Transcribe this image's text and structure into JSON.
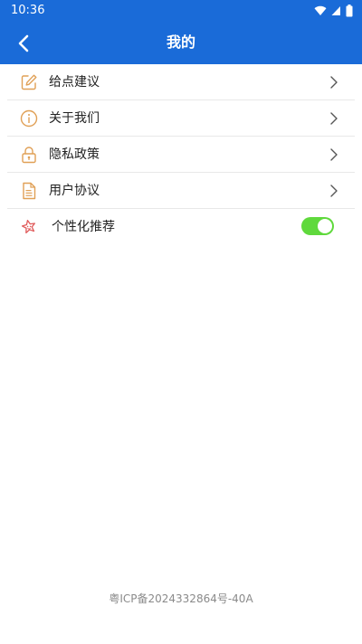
{
  "status_bar": {
    "time": "10:36",
    "icons": [
      "wifi-icon",
      "signal-icon",
      "battery-icon"
    ]
  },
  "header": {
    "title": "我的",
    "back_icon": "chevron-left-icon"
  },
  "menu": {
    "items": [
      {
        "label": "给点建议",
        "icon": "edit-icon",
        "trailing": "chevron-right-icon"
      },
      {
        "label": "关于我们",
        "icon": "info-icon",
        "trailing": "chevron-right-icon"
      },
      {
        "label": "隐私政策",
        "icon": "lock-icon",
        "trailing": "chevron-right-icon"
      },
      {
        "label": "用户协议",
        "icon": "document-icon",
        "trailing": "chevron-right-icon"
      },
      {
        "label": "个性化推荐",
        "icon": "star-face-icon",
        "trailing": "toggle",
        "toggle_on": true
      }
    ]
  },
  "footer": {
    "icp": "粤ICP备2024332864号-40A"
  },
  "colors": {
    "primary": "#1a6bd8",
    "icon_orange": "#e0a056",
    "icon_red": "#e05a5a",
    "toggle_on": "#5fd93c",
    "footer_text": "#8a8a8a"
  }
}
